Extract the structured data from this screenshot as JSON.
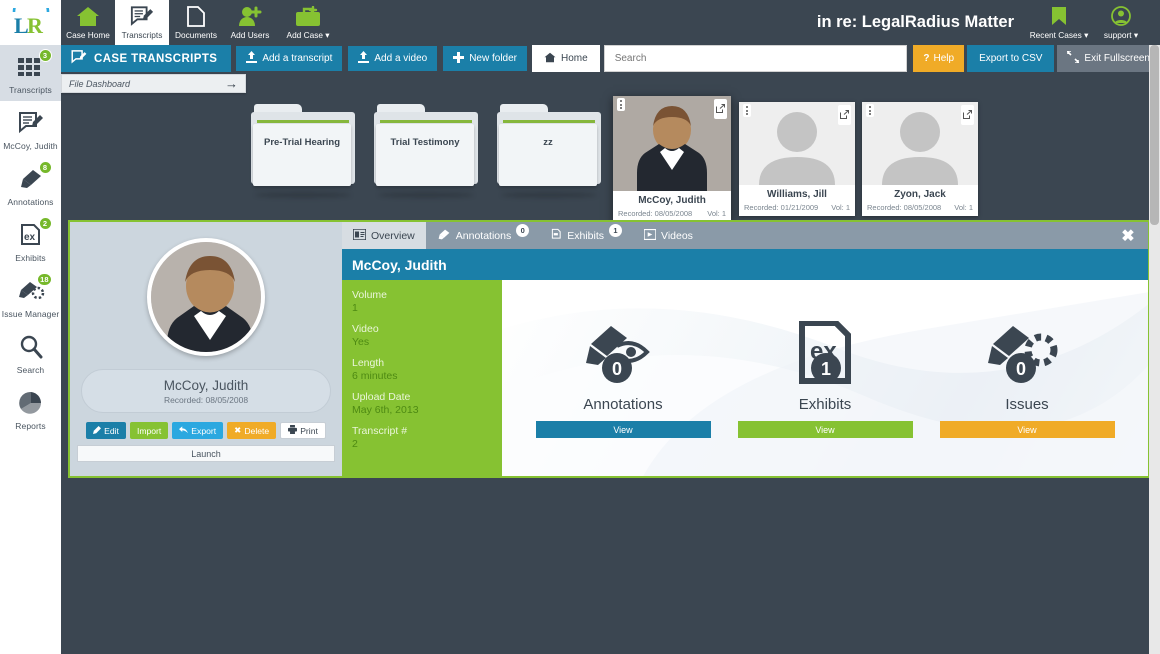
{
  "app": {
    "logo_alt": "LegalRadius logo",
    "matter_title": "in re: LegalRadius Matter"
  },
  "sidebar": {
    "items": [
      {
        "label": "Transcripts",
        "icon": "grid-icon",
        "badge": "3",
        "active": true
      },
      {
        "label": "McCoy, Judith",
        "icon": "transcript-icon",
        "badge": "",
        "active": false
      },
      {
        "label": "Annotations",
        "icon": "highlighter-icon",
        "badge": "8",
        "active": false
      },
      {
        "label": "Exhibits",
        "icon": "exhibit-icon",
        "badge": "2",
        "active": false
      },
      {
        "label": "Issue Manager",
        "icon": "issue-icon",
        "badge": "18",
        "active": false
      },
      {
        "label": "Search",
        "icon": "search-icon",
        "badge": "",
        "active": false
      },
      {
        "label": "Reports",
        "icon": "reports-icon",
        "badge": "",
        "active": false
      }
    ]
  },
  "topnav": {
    "items": [
      {
        "label": "Case Home",
        "icon": "home-icon",
        "active": false,
        "caret": false
      },
      {
        "label": "Transcripts",
        "icon": "transcript-icon",
        "active": true,
        "caret": false
      },
      {
        "label": "Documents",
        "icon": "document-icon",
        "active": false,
        "caret": false
      },
      {
        "label": "Add Users",
        "icon": "add-user-icon",
        "active": false,
        "caret": false
      },
      {
        "label": "Add Case",
        "icon": "briefcase-icon",
        "active": false,
        "caret": true
      }
    ],
    "right": [
      {
        "label": "Recent Cases",
        "icon": "bookmark-icon",
        "caret": true
      },
      {
        "label": "support",
        "icon": "user-icon",
        "caret": true
      }
    ]
  },
  "toolbar": {
    "title": "CASE TRANSCRIPTS",
    "title_icon": "transcript-icon",
    "buttons": [
      {
        "label": "Add a transcript",
        "icon": "upload-icon"
      },
      {
        "label": "Add a video",
        "icon": "upload-icon"
      },
      {
        "label": "New folder",
        "icon": "plus-icon"
      }
    ],
    "home_label": "Home",
    "home_icon": "home-icon",
    "search_placeholder": "Search",
    "search_value": "",
    "help_label": "Help",
    "help_icon": "question-icon",
    "export_csv_label": "Export to CSV",
    "fullscreen_label": "Exit Fullscreen",
    "fullscreen_icon": "shrink-icon"
  },
  "breadcrumb": {
    "label": "File Dashboard",
    "arrow": "→"
  },
  "folders": [
    {
      "name": "Pre-Trial Hearing"
    },
    {
      "name": "Trial Testimony"
    },
    {
      "name": "zz"
    }
  ],
  "transcript_cards": [
    {
      "name": "McCoy, Judith",
      "recorded": "Recorded: 08/05/2008",
      "volume": "Vol: 1",
      "has_photo": true,
      "selected": true
    },
    {
      "name": "Williams, Jill",
      "recorded": "Recorded: 01/21/2009",
      "volume": "Vol: 1",
      "has_photo": false,
      "selected": false
    },
    {
      "name": "Zyon, Jack",
      "recorded": "Recorded: 08/05/2008",
      "volume": "Vol: 1",
      "has_photo": false,
      "selected": false
    }
  ],
  "panel": {
    "tabs": [
      {
        "label": "Overview",
        "icon": "overview-icon",
        "badge": "",
        "active": true
      },
      {
        "label": "Annotations",
        "icon": "highlighter-icon",
        "badge": "0",
        "active": false
      },
      {
        "label": "Exhibits",
        "icon": "exhibit-icon",
        "badge": "1",
        "active": false
      },
      {
        "label": "Videos",
        "icon": "video-icon",
        "badge": "",
        "active": false
      }
    ],
    "close_label": "✖",
    "title": "McCoy, Judith",
    "person": {
      "name": "McCoy, Judith",
      "recorded": "Recorded: 08/05/2008"
    },
    "actions": [
      {
        "label": "Edit",
        "icon": "pencil-icon",
        "style": "edit"
      },
      {
        "label": "Import",
        "icon": "",
        "style": "import"
      },
      {
        "label": "Export",
        "icon": "reply-icon",
        "style": "export"
      },
      {
        "label": "Delete",
        "icon": "x-icon",
        "style": "delete"
      },
      {
        "label": "Print",
        "icon": "printer-icon",
        "style": "print"
      }
    ],
    "launch_label": "Launch",
    "info": [
      {
        "label": "Volume",
        "value": "1"
      },
      {
        "label": "Video",
        "value": "Yes"
      },
      {
        "label": "Length",
        "value": "6 minutes"
      },
      {
        "label": "Upload Date",
        "value": "May 6th, 2013"
      },
      {
        "label": "Transcript #",
        "value": "2"
      }
    ],
    "stats": [
      {
        "label": "Annotations",
        "count": "0",
        "button": "View",
        "color": "blue",
        "icon": "highlighter-eye-icon"
      },
      {
        "label": "Exhibits",
        "count": "1",
        "button": "View",
        "color": "green",
        "icon": "exhibit-doc-icon"
      },
      {
        "label": "Issues",
        "count": "0",
        "button": "View",
        "color": "orange",
        "icon": "highlighter-gear-icon"
      }
    ]
  },
  "colors": {
    "dark": "#3b4651",
    "blue": "#1b7fa8",
    "green": "#86c232",
    "orange": "#f0ab27",
    "light_blue": "#2ba8e0",
    "gray": "#6b7682"
  }
}
